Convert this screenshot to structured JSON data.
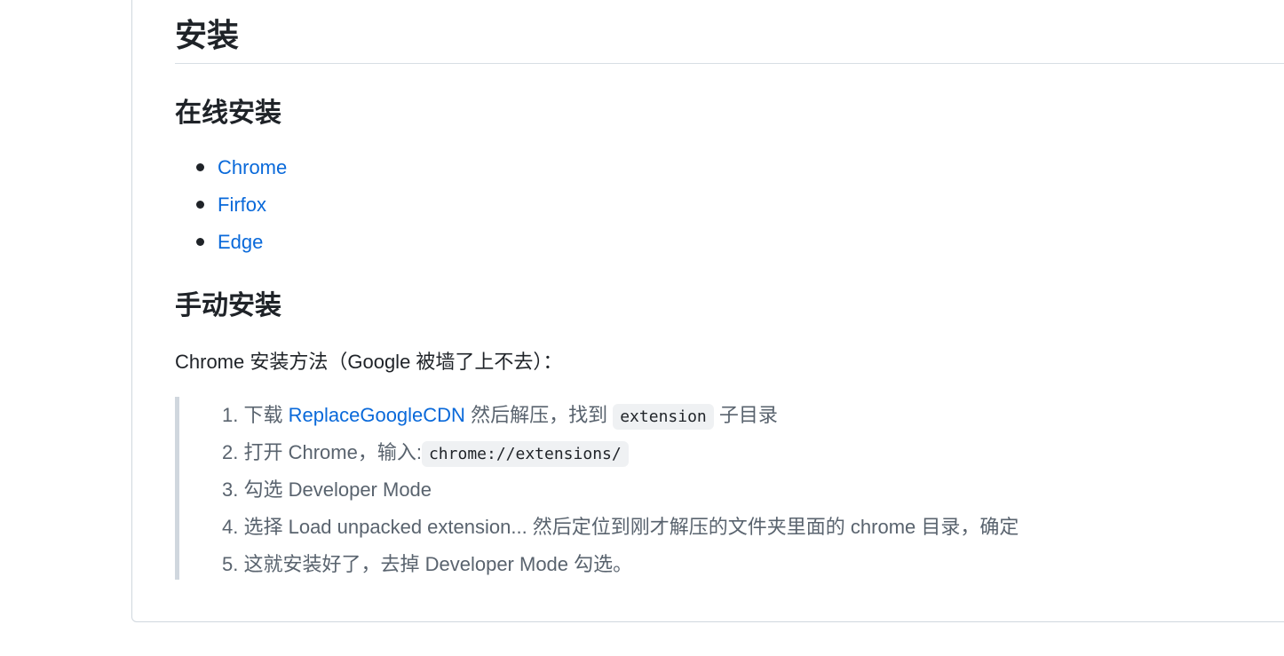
{
  "heading": "安装",
  "online": {
    "heading": "在线安装",
    "links": [
      "Chrome",
      "Firfox",
      "Edge"
    ]
  },
  "manual": {
    "heading": "手动安装",
    "intro": "Chrome 安装方法（Google 被墙了上不去）：",
    "steps": {
      "s1": {
        "num": "1.",
        "pre": "下载",
        "link": "ReplaceGoogleCDN",
        "mid": "然后解压，找到",
        "code": "extension",
        "post": "子目录"
      },
      "s2": {
        "num": "2.",
        "pre": "打开 Chrome，输入:",
        "code": "chrome://extensions/"
      },
      "s3": {
        "num": "3.",
        "text": "勾选 Developer Mode"
      },
      "s4": {
        "num": "4.",
        "text": "选择 Load unpacked extension... 然后定位到刚才解压的文件夹里面的 chrome 目录，确定"
      },
      "s5": {
        "num": "5.",
        "text": "这就安装好了，去掉 Developer Mode 勾选。"
      }
    }
  },
  "colors": {
    "link": "#0969da",
    "text": "#1f2328",
    "muted": "#59636e",
    "border": "#d0d7de",
    "code_bg": "#eff1f3"
  }
}
